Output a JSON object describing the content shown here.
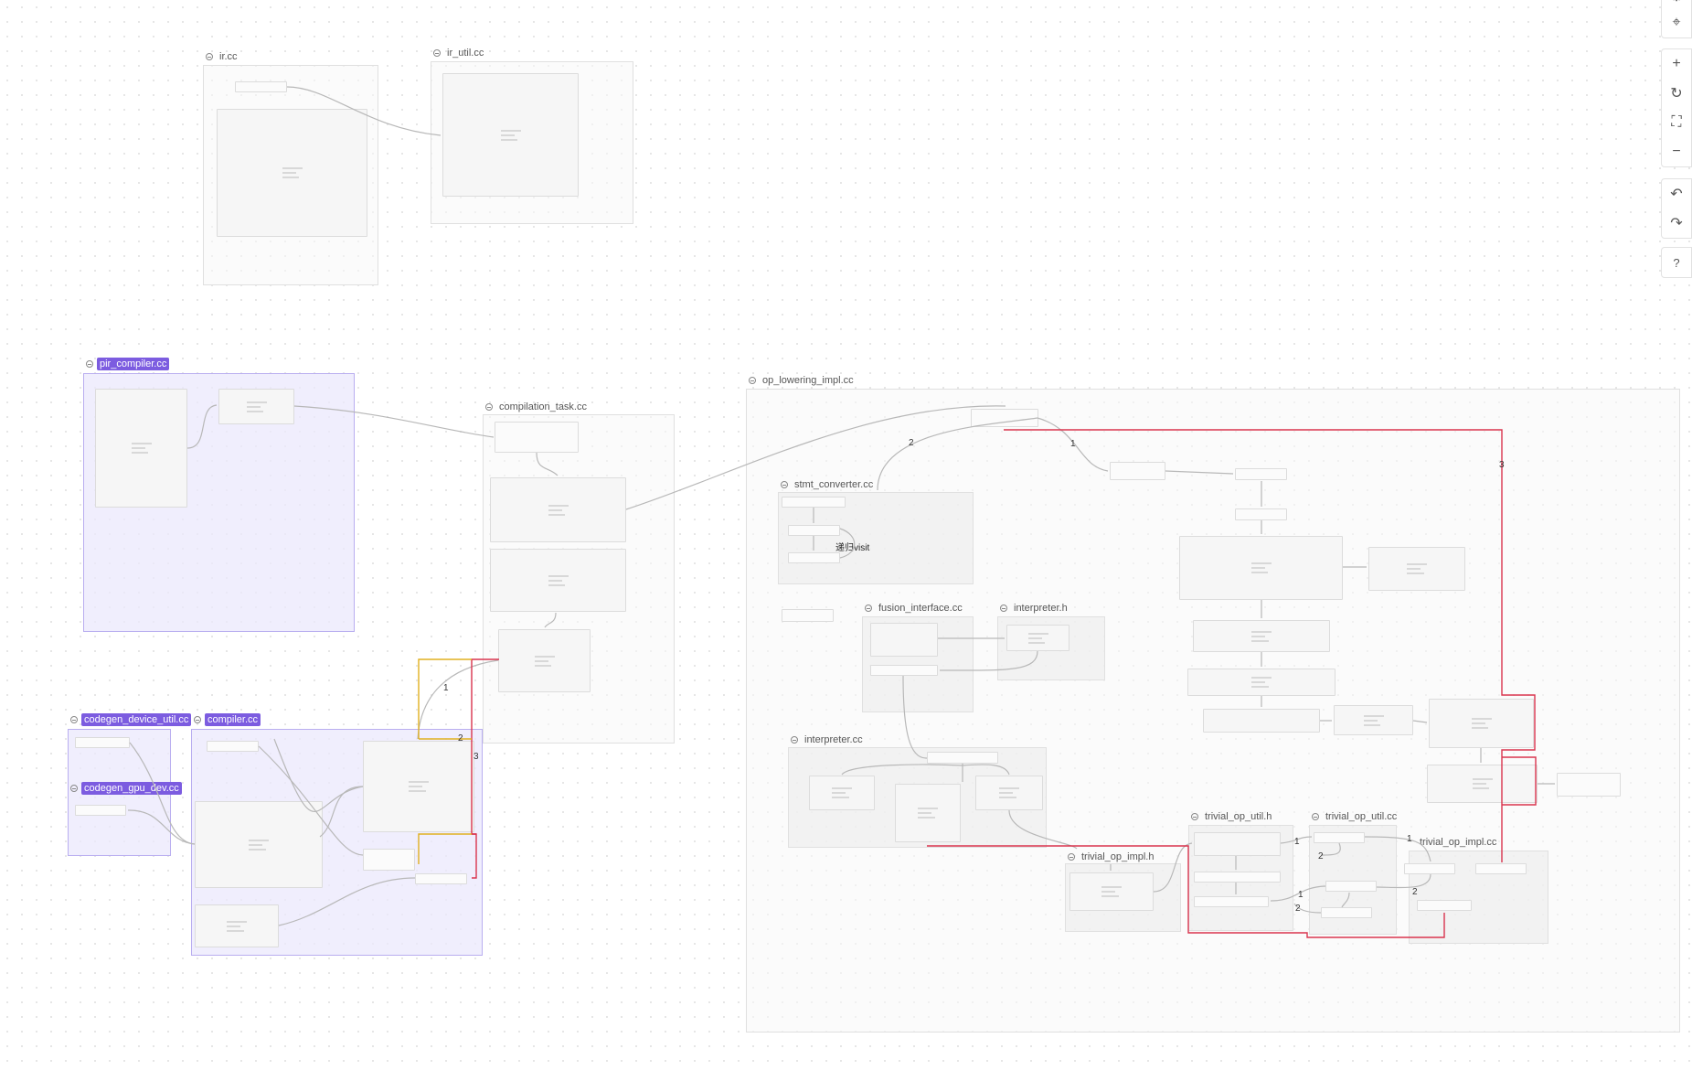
{
  "groups": {
    "ir_cc": "ir.cc",
    "ir_util_cc": "ir_util.cc",
    "pir_compiler_cc": "pir_compiler.cc",
    "compilation_task_cc": "compilation_task.cc",
    "op_lowering_impl_cc": "op_lowering_impl.cc",
    "stmt_converter_cc": "stmt_converter.cc",
    "fusion_interface_cc": "fusion_interface.cc",
    "interpreter_h": "interpreter.h",
    "interpreter_cc": "interpreter.cc",
    "trivial_op_util_h": "trivial_op_util.h",
    "trivial_op_util_cc": "trivial_op_util.cc",
    "trivial_op_impl_h": "trivial_op_impl.h",
    "trivial_op_impl_cc": "trivial_op_impl.cc",
    "codegen_device_util_cc": "codegen_device_util.cc",
    "compiler_cc": "compiler.cc",
    "codegen_gpu_dev_cc": "codegen_gpu_dev.cc"
  },
  "edge_labels": {
    "op_lowering_2": "2",
    "op_lowering_1": "1",
    "op_lowering_3": "3",
    "compiler_1": "1",
    "compiler_2": "2",
    "compiler_3": "3",
    "trivial_util_1a": "1",
    "trivial_util_2a": "2",
    "trivial_util_1b": "1",
    "trivial_util_2b": "2",
    "trivial_impl_1": "1",
    "trivial_impl_2": "2"
  },
  "annotations": {
    "recursive_visit": "递归visit"
  },
  "colors": {
    "highlight_red": "#d9344e",
    "highlight_yellow": "#e0b020",
    "edge_gray": "#b8b8b8",
    "selected_group": "#7c5ce0"
  },
  "toolbar": {
    "icons": [
      "settings-icon",
      "fit-view-icon",
      "zoom-in-icon",
      "refresh-icon",
      "fullscreen-icon",
      "zoom-out-icon",
      "undo-icon",
      "redo-icon",
      "help-icon"
    ],
    "glyphs": {
      "settings": "⚙",
      "fit": "⌖",
      "zoom_in": "+",
      "refresh": "↻",
      "fullscreen": "⛶",
      "zoom_out": "−",
      "undo": "↶",
      "redo": "↷",
      "help": "?"
    }
  }
}
